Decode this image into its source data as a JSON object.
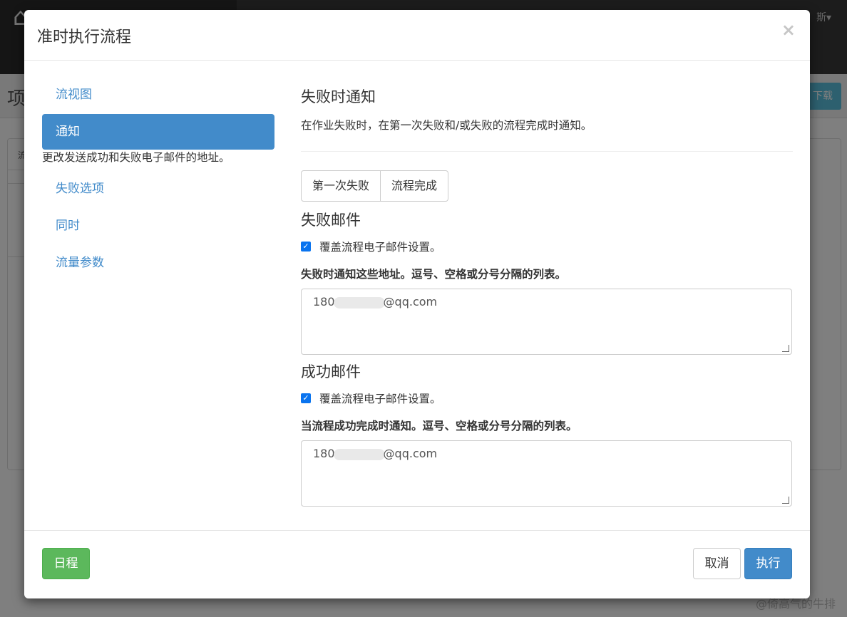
{
  "background": {
    "user_label": "斯▾",
    "page_title_fragment": "项",
    "download_label": "下载",
    "tab_fragment": "流",
    "watermark": "@倚高气的牛排"
  },
  "modal": {
    "title": "准时执行流程",
    "close_glyph": "×",
    "sidebar": {
      "items": [
        {
          "label": "流视图"
        },
        {
          "label": "通知"
        },
        {
          "label": "失败选项"
        },
        {
          "label": "同时"
        },
        {
          "label": "流量参数"
        }
      ],
      "active_desc": "更改发送成功和失败电子邮件的地址。"
    },
    "content": {
      "heading": "失败时通知",
      "description": "在作业失败时，在第一次失败和/或失败的流程完成时通知。",
      "toggle": {
        "first_failure": "第一次失败",
        "flow_complete": "流程完成"
      },
      "failure_email": {
        "heading": "失败邮件",
        "override_label": "覆盖流程电子邮件设置。",
        "field_label": "失败时通知这些地址。逗号、空格或分号分隔的列表。",
        "value_prefix": "180",
        "value_suffix": "@qq.com"
      },
      "success_email": {
        "heading": "成功邮件",
        "override_label": "覆盖流程电子邮件设置。",
        "field_label": "当流程成功完成时通知。逗号、空格或分号分隔的列表。",
        "value_prefix": "180",
        "value_suffix": "@qq.com"
      }
    },
    "footer": {
      "schedule_label": "日程",
      "cancel_label": "取消",
      "execute_label": "执行"
    }
  }
}
